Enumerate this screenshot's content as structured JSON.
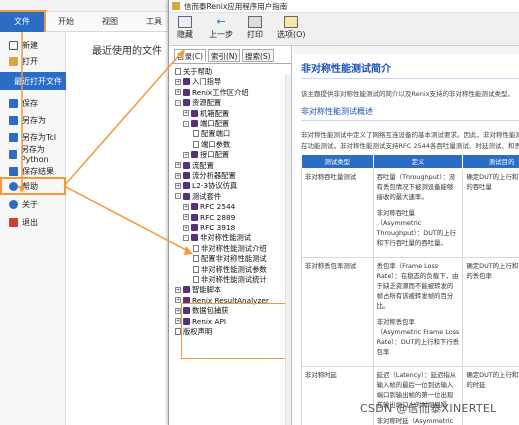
{
  "app": {
    "tabs": [
      "文件",
      "开始",
      "视图",
      "工具"
    ],
    "active_tab": "文件",
    "sidebar": [
      {
        "label": "新建",
        "icon": "new-doc-icon",
        "color": "#555555"
      },
      {
        "label": "打开",
        "icon": "open-folder-icon",
        "color": "#d9a441"
      },
      {
        "label": "最近打开文件",
        "icon": "",
        "color": ""
      },
      {
        "label": "保存",
        "icon": "save-icon",
        "color": "#2b6cc4"
      },
      {
        "label": "另存为",
        "icon": "save-as-icon",
        "color": "#2b6cc4"
      },
      {
        "label": "另存为Tcl",
        "icon": "save-tcl-icon",
        "color": "#2b6cc4"
      },
      {
        "label": "另存为Python",
        "icon": "save-python-icon",
        "color": "#2b6cc4"
      },
      {
        "label": "保存结果",
        "icon": "save-result-icon",
        "color": "#2b6cc4"
      },
      {
        "label": "帮助",
        "icon": "help-icon",
        "color": "#2b6cc4"
      },
      {
        "label": "关于",
        "icon": "info-icon",
        "color": "#2b6cc4"
      },
      {
        "label": "退出",
        "icon": "exit-icon",
        "color": "#d04030"
      }
    ],
    "recent_title": "最近使用的文件"
  },
  "help": {
    "title": "信而泰Renix应用程序用户指南",
    "toolbar": [
      "隐藏",
      "上一步",
      "打印",
      "选项(O)"
    ],
    "nav_tabs": [
      "目录(C)",
      "索引(N)",
      "搜索(S)"
    ],
    "tree": [
      {
        "label": "关于帮助",
        "type": "page",
        "toggle": ""
      },
      {
        "label": "入门指导",
        "type": "book",
        "toggle": "+"
      },
      {
        "label": "Renix工作区介绍",
        "type": "book",
        "toggle": "+"
      },
      {
        "label": "资源配置",
        "type": "book",
        "toggle": "-"
      },
      {
        "label": "机箱配置",
        "type": "book",
        "toggle": "+"
      },
      {
        "label": "端口配置",
        "type": "book",
        "toggle": "-"
      },
      {
        "label": "配置端口",
        "type": "page",
        "toggle": ""
      },
      {
        "label": "端口参数",
        "type": "page",
        "toggle": ""
      },
      {
        "label": "接口配置",
        "type": "book",
        "toggle": "+"
      },
      {
        "label": "流配置",
        "type": "book",
        "toggle": "+"
      },
      {
        "label": "流分析器配置",
        "type": "book",
        "toggle": "+"
      },
      {
        "label": "L2-3协议仿真",
        "type": "book",
        "toggle": "+"
      },
      {
        "label": "测试套件",
        "type": "book",
        "toggle": "-"
      },
      {
        "label": "RFC 2544",
        "type": "book",
        "toggle": "+"
      },
      {
        "label": "RFC 2889",
        "type": "book",
        "toggle": "+"
      },
      {
        "label": "RFC 3918",
        "type": "book",
        "toggle": "+"
      },
      {
        "label": "非对称性能测试",
        "type": "book",
        "toggle": "-"
      },
      {
        "label": "非对称性能测试介绍",
        "type": "page",
        "toggle": ""
      },
      {
        "label": "配置非对称性能测试",
        "type": "page",
        "toggle": ""
      },
      {
        "label": "非对称性能测试参数",
        "type": "page",
        "toggle": ""
      },
      {
        "label": "非对称性能测试统计",
        "type": "page",
        "toggle": ""
      },
      {
        "label": "智能脚本",
        "type": "book",
        "toggle": "+"
      },
      {
        "label": "Renix ResultAnalyzer",
        "type": "book",
        "toggle": "+"
      },
      {
        "label": "数据包捕获",
        "type": "book",
        "toggle": "+"
      },
      {
        "label": "Renix API",
        "type": "book",
        "toggle": "+"
      },
      {
        "label": "版权声明",
        "type": "page",
        "toggle": ""
      }
    ],
    "content": {
      "heading": "非对称性能测试简介",
      "intro": "该主题提供非对称性能测试的简介以及Renix支持的非对称性能测试类型。",
      "subheading": "非对称性能测试概述",
      "desc_line1": "非对称性能测试中定义了网络互连设备的基本测试要求。因此，非对称性能测试是一",
      "desc_line2": "在功能测试，非对称性能测试支持RFC 2544各吞吐量测试、时延测试、和丢包率测试。",
      "columns": [
        "测试类型",
        "定义",
        "测试目的"
      ],
      "rows": [
        {
          "type": "非对称吞吐量测试",
          "def": [
            "吞吐量（Throughput）：没有丢包情况下被测设备能够接收的最大速率。",
            "非对称吞吐量（Asymmetric Throughput）：DUT的上行和下行吞吐量的吞吐量。"
          ],
          "purpose": "确定DUT的上行和下行的吞吐量"
        },
        {
          "type": "非对称丢包率测试",
          "def": [
            "丢包率（Frame Loss Rate）：在稳态的负载下，由于缺乏资源而不能被转发的帧占所有该被转发帧的百分比。",
            "非对称丢包率（Asymmetric Frame Loss Rate）：DUT的上行和下行丢包率"
          ],
          "purpose": "确定DUT的上行和下行的丢包率"
        },
        {
          "type": "非对称时延",
          "def": [
            "延迟（Latency）：延迟指从输入帧的最后一位到达输入端口到输出帧的第一位出现在输出端口上的时间间隔",
            "非对称时延（Asymmetric Latency）"
          ],
          "purpose": "确定DUT的上行和下行的时延"
        }
      ]
    }
  },
  "watermark": "CSDN @信而泰XINERTEL",
  "colors": {
    "accent": "#2b6cc4",
    "highlight": "#f29a3a",
    "heading": "#1a4fb3"
  }
}
